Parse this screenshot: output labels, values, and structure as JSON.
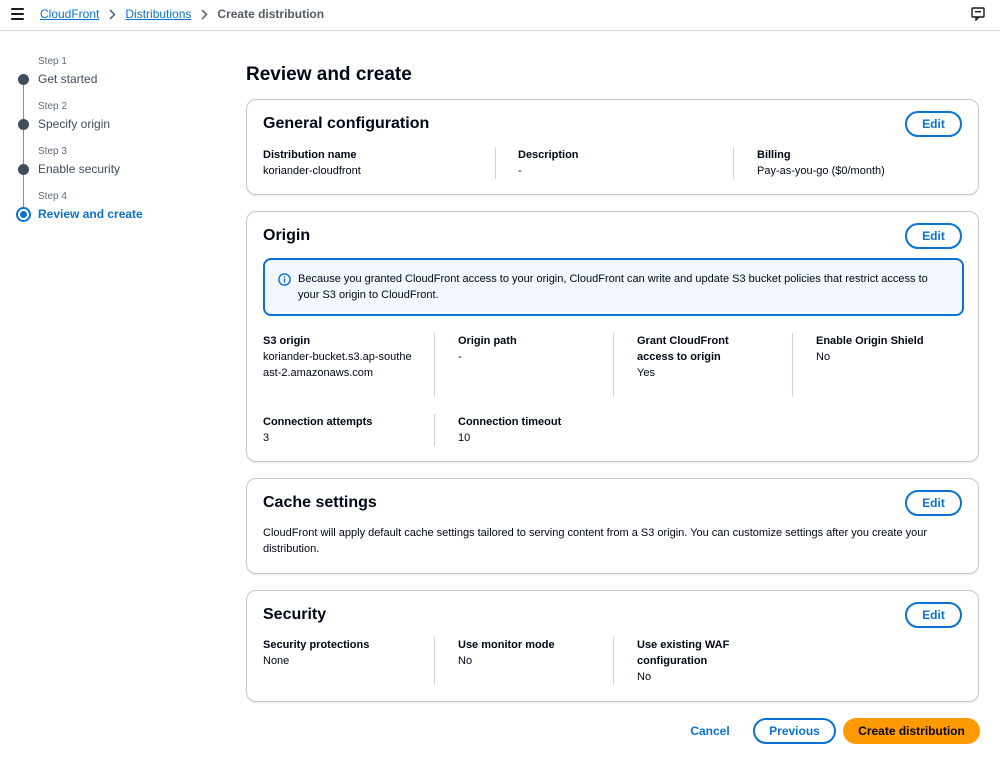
{
  "breadcrumb": {
    "items": [
      "CloudFront",
      "Distributions"
    ],
    "current": "Create distribution"
  },
  "steps": [
    {
      "number": "Step 1",
      "title": "Get started"
    },
    {
      "number": "Step 2",
      "title": "Specify origin"
    },
    {
      "number": "Step 3",
      "title": "Enable security"
    },
    {
      "number": "Step 4",
      "title": "Review and create"
    }
  ],
  "page": {
    "title": "Review and create"
  },
  "general": {
    "title": "General configuration",
    "edit_label": "Edit",
    "fields": [
      {
        "label": "Distribution name",
        "value": "koriander-cloudfront"
      },
      {
        "label": "Description",
        "value": "-"
      },
      {
        "label": "Billing",
        "value": "Pay-as-you-go ($0/month)"
      }
    ]
  },
  "origin": {
    "title": "Origin",
    "edit_label": "Edit",
    "info": "Because you granted CloudFront access to your origin, CloudFront can write and update S3 bucket policies that restrict access to your S3 origin to CloudFront.",
    "fields": [
      {
        "label": "S3 origin",
        "value": "koriander-bucket.s3.ap-southeast-2.amazonaws.com"
      },
      {
        "label": "Origin path",
        "value": "-"
      },
      {
        "label": "Grant CloudFront access to origin",
        "value": "Yes"
      },
      {
        "label": "Enable Origin Shield",
        "value": "No"
      },
      {
        "label": "Connection attempts",
        "value": "3"
      },
      {
        "label": "Connection timeout",
        "value": "10"
      }
    ]
  },
  "cache": {
    "title": "Cache settings",
    "edit_label": "Edit",
    "text": "CloudFront will apply default cache settings tailored to serving content from a S3 origin. You can customize settings after you create your distribution."
  },
  "security": {
    "title": "Security",
    "edit_label": "Edit",
    "fields": [
      {
        "label": "Security protections",
        "value": "None"
      },
      {
        "label": "Use monitor mode",
        "value": "No"
      },
      {
        "label": "Use existing WAF configuration",
        "value": "No"
      }
    ]
  },
  "footer": {
    "cancel": "Cancel",
    "previous": "Previous",
    "create": "Create distribution"
  },
  "colors": {
    "link": "#0972d3",
    "primary_button": "#ff9900",
    "info_bg": "#f2f8fd"
  }
}
